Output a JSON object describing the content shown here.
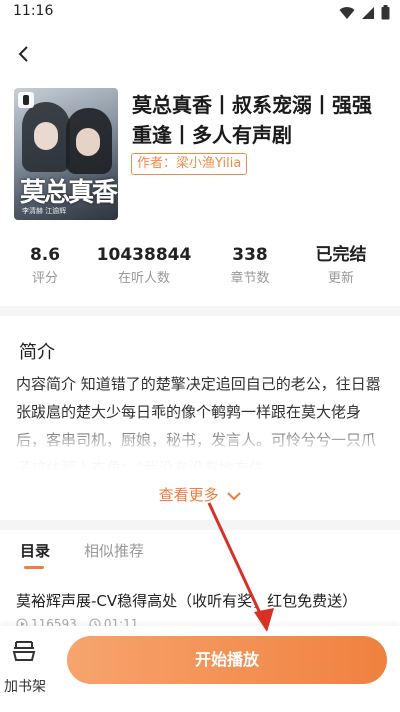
{
  "status_bar": {
    "time": "11:16"
  },
  "book": {
    "cover_title": "莫总真香",
    "cover_credit": "李清赫  江逾辉",
    "title": "莫总真香丨叔系宠溺丨强强重逢丨多人有声剧",
    "author": "作者：梁小渔Yilia"
  },
  "stats": [
    {
      "value": "8.6",
      "label": "评分"
    },
    {
      "value": "10438844",
      "label": "在听人数"
    },
    {
      "value": "338",
      "label": "章节数"
    },
    {
      "value": "已完结",
      "label": "更新"
    }
  ],
  "intro": {
    "heading": "简介",
    "text": "内容简介   知道错了的楚擎决定追回自己的老公，往日嚣张跋扈的楚大少每日乖的像个鹌鹑一样跟在莫大佬身后，客串司机，厨娘，秘书，发言人。可怜兮兮一只爪子拉住那人衣角：“我没有没有地方住，",
    "see_more": "查看更多"
  },
  "tabs": {
    "catalog": "目录",
    "similar": "相似推荐"
  },
  "episode": {
    "title": "莫裕辉声展-CV稳得高处（收听有奖，红包免费送）",
    "plays": "116593",
    "duration": "01:11"
  },
  "bottom": {
    "shelf_label": "加书架",
    "play_label": "开始播放"
  },
  "colors": {
    "accent": "#f07d3c",
    "annotation_arrow": "#d93025"
  }
}
